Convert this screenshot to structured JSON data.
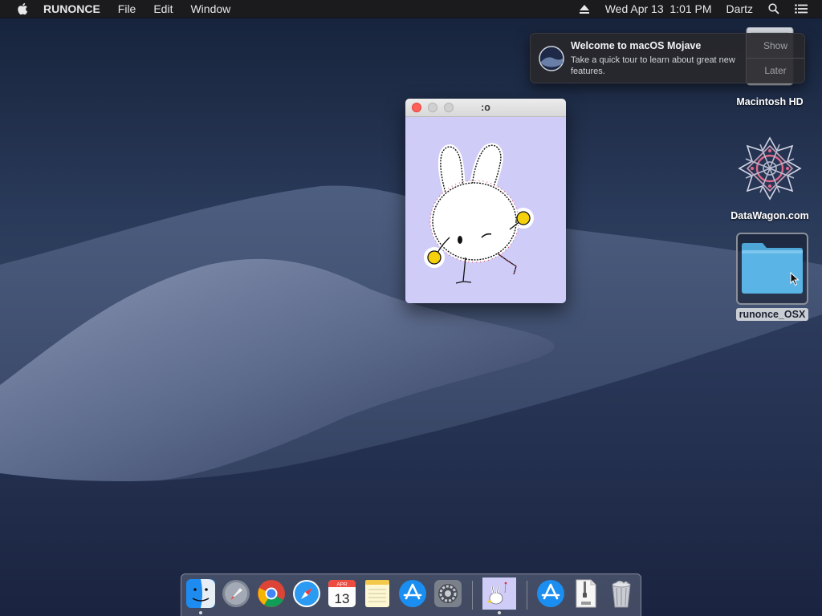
{
  "menubar": {
    "app_name": "RUNONCE",
    "menus": [
      "File",
      "Edit",
      "Window"
    ],
    "datetime": "Wed Apr 13  1:01 PM",
    "user": "Dartz",
    "icons": [
      "apple-icon",
      "eject-icon",
      "spotlight-icon",
      "notification-center-icon"
    ]
  },
  "notification": {
    "title": "Welcome to macOS Mojave",
    "body": "Take a quick tour to learn about great new features.",
    "show_label": "Show",
    "later_label": "Later",
    "icon": "mojave-icon"
  },
  "desktop": {
    "icons": [
      {
        "label": "Macintosh HD",
        "icon": "hard-drive-icon"
      },
      {
        "label": "DataWagon.com",
        "icon": "datawagon-logo-icon"
      },
      {
        "label": "runonce_OSX",
        "icon": "folder-icon",
        "selected": true
      }
    ]
  },
  "window": {
    "title": ":o",
    "background": "#cfcdf8",
    "content": "bunny-illustration"
  },
  "dock": {
    "calendar_month": "APR",
    "calendar_day": "13",
    "items": [
      "finder",
      "launchpad",
      "chrome",
      "safari",
      "calendar",
      "notes",
      "app-store",
      "system-preferences",
      "runonce",
      "app-store-download",
      "zip-archive",
      "trash"
    ]
  },
  "colors": {
    "menubar_bg": "#1b1b1e",
    "close_red": "#fe5f57",
    "folder_blue": "#5ab4e6"
  }
}
